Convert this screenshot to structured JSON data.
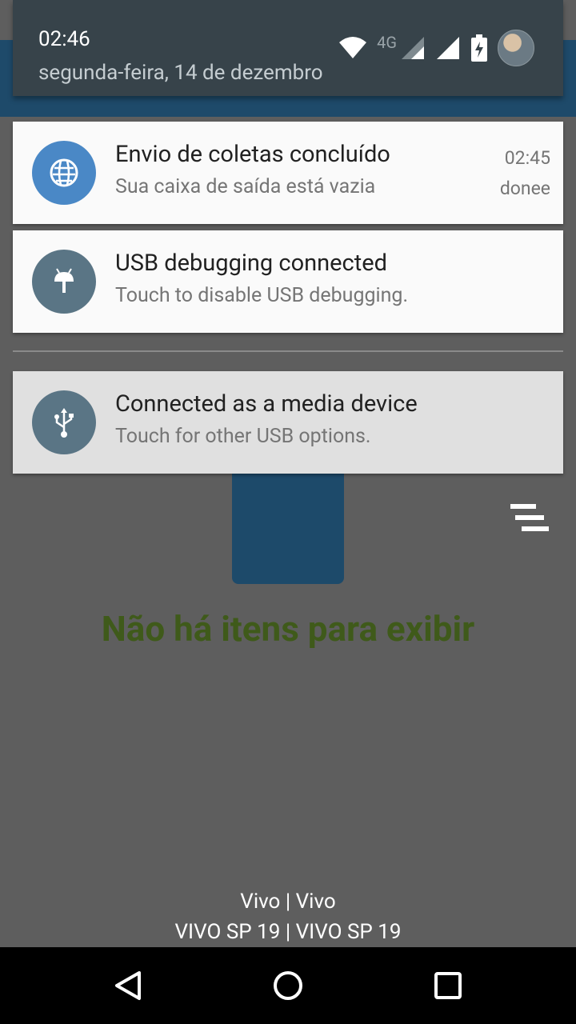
{
  "status": {
    "time": "02:46",
    "date": "segunda-feira, 14 de dezembro",
    "network_type": "4G",
    "icons": [
      "wifi-icon",
      "signal-icon",
      "signal-icon",
      "battery-charging-icon",
      "avatar"
    ]
  },
  "notifications": [
    {
      "icon": "globe-icon",
      "icon_color": "#4a88c6",
      "title": "Envio de coletas concluído",
      "text": "Sua caixa de saída está vazia",
      "time": "02:45",
      "info": "donee"
    },
    {
      "icon": "android-icon",
      "icon_color": "#5a7585",
      "title": "USB debugging connected",
      "text": "Touch to disable USB debugging."
    },
    {
      "icon": "usb-icon",
      "icon_color": "#5a7585",
      "title": "Connected as a media device",
      "text": "Touch for other USB options."
    }
  ],
  "app": {
    "empty_message": "Não há itens para exibir",
    "carrier_line1": "Vivo | Vivo",
    "carrier_line2": "VIVO SP 19 | VIVO SP 19"
  },
  "navbar": {
    "buttons": [
      "back-icon",
      "home-icon",
      "recents-icon"
    ]
  }
}
